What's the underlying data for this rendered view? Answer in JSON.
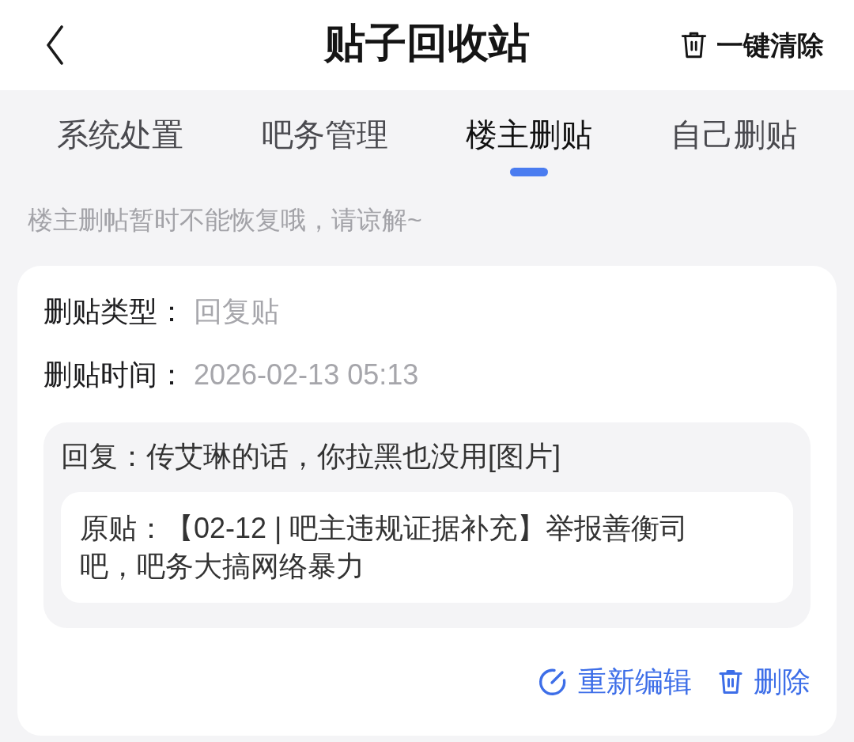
{
  "header": {
    "title": "贴子回收站",
    "clear_all": "一键清除"
  },
  "tabs": [
    {
      "label": "系统处置",
      "selected": false
    },
    {
      "label": "吧务管理",
      "selected": false
    },
    {
      "label": "楼主删贴",
      "selected": true
    },
    {
      "label": "自己删贴",
      "selected": false
    }
  ],
  "notice": "楼主删帖暂时不能恢复哦，请谅解~",
  "posts": [
    {
      "fields": [
        {
          "label": "删贴类型：",
          "value": "回复贴"
        },
        {
          "label": "删贴时间：",
          "value": "2026-02-13 05:13"
        }
      ],
      "reply": "回复：传艾琳的话，你拉黑也没用[图片]",
      "original": "原贴：【02-12 | 吧主违规证据补充】举报善衡司吧，吧务大搞网络暴力",
      "actions": [
        {
          "kind": "edit",
          "label": "重新编辑"
        },
        {
          "kind": "delete",
          "label": "删除"
        }
      ]
    }
  ]
}
